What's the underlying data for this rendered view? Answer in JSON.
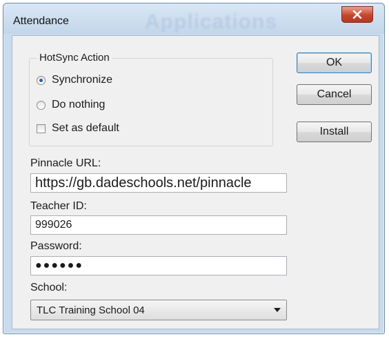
{
  "window": {
    "title": "Attendance",
    "background_title": "Applications"
  },
  "hotsync": {
    "legend": "HotSync Action",
    "options": [
      {
        "label": "Synchronize",
        "checked": true
      },
      {
        "label": "Do nothing",
        "checked": false
      }
    ],
    "set_default_label": "Set as default",
    "set_default_checked": false
  },
  "buttons": {
    "ok": "OK",
    "cancel": "Cancel",
    "install": "Install"
  },
  "fields": {
    "url_label": "Pinnacle URL:",
    "url_value": "https://gb.dadeschools.net/pinnacle",
    "teacher_label": "Teacher ID:",
    "teacher_value": "999026",
    "password_label": "Password:",
    "password_value": "●●●●●●",
    "school_label": "School:",
    "school_value": "TLC Training School 04"
  },
  "colors": {
    "close_button": "#c6462d",
    "radio_dot": "#2b5fa8",
    "default_button_border": "#3c7fb1"
  }
}
